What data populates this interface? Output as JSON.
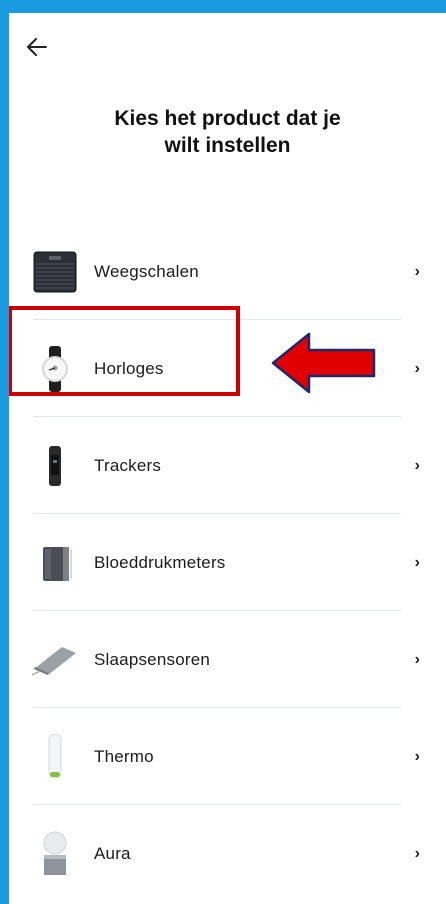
{
  "header": {
    "back_icon": "arrow-left-icon",
    "title_line1": "Kies het product   dat je",
    "title_line2": "wilt instellen"
  },
  "products": [
    {
      "label": "Weegschalen",
      "icon": "scale-icon"
    },
    {
      "label": "Horloges",
      "icon": "watch-icon"
    },
    {
      "label": "Trackers",
      "icon": "tracker-icon"
    },
    {
      "label": "Bloeddrukmeters",
      "icon": "blood-pressure-monitor-icon"
    },
    {
      "label": "Slaapsensoren",
      "icon": "sleep-sensor-icon"
    },
    {
      "label": "Thermo",
      "icon": "thermometer-icon"
    },
    {
      "label": "Aura",
      "icon": "aura-lamp-icon"
    }
  ],
  "chevron": "›",
  "annotation": {
    "highlight_color": "#cc0000",
    "arrow_fill": "#e00000",
    "arrow_stroke": "#1a2a6c",
    "highlighted_item": "Horloges"
  },
  "colors": {
    "frame": "#1a9be0",
    "background": "#ffffff",
    "divider": "#e2e8ee"
  }
}
